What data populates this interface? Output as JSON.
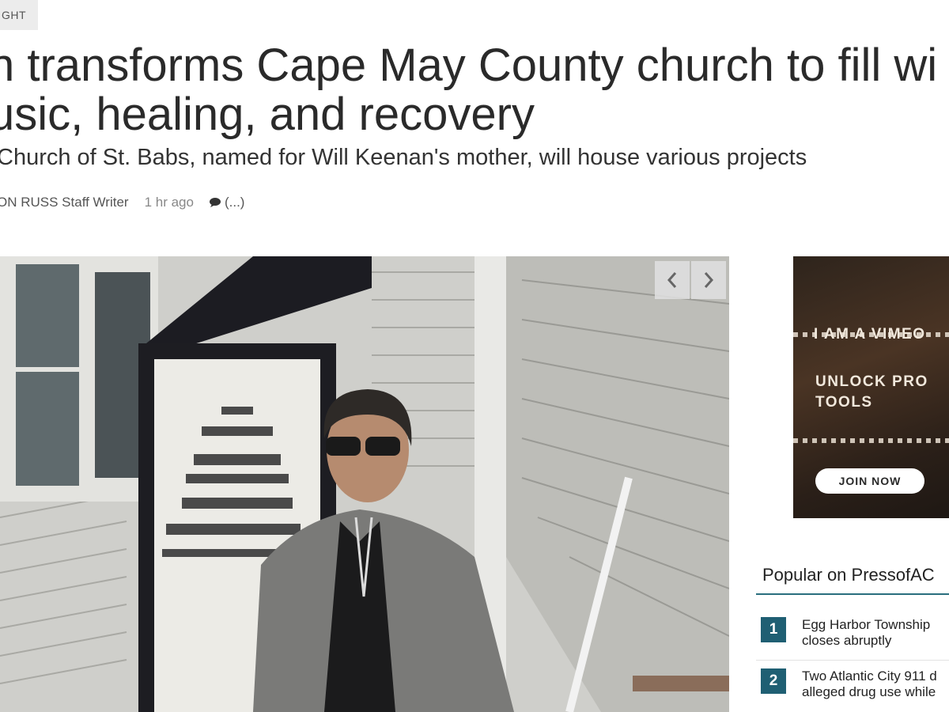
{
  "article": {
    "section_tag": "GHT",
    "headline_line1": "n transforms Cape May County church to fill wi",
    "headline_line2": "usic, healing, and recovery",
    "subheadline": "Church of St. Babs, named for Will Keenan's mother, will house various projects",
    "author": "ON RUSS Staff Writer",
    "timestamp": "1 hr ago",
    "comments": "(...)"
  },
  "gallery": {
    "prev_icon": "chevron-left-icon",
    "next_icon": "chevron-right-icon"
  },
  "ad": {
    "line1": "I AM A VIMEO",
    "line2a": "UNLOCK PRO",
    "line2b": "TOOLS",
    "button": "JOIN NOW"
  },
  "popular": {
    "title": "Popular on PressofAC",
    "items": [
      {
        "rank": "1",
        "line1": "Egg Harbor Township",
        "line2": "closes abruptly"
      },
      {
        "rank": "2",
        "line1": "Two Atlantic City 911 d",
        "line2": "alleged drug use while"
      }
    ]
  },
  "colors": {
    "accent": "#1f5f73",
    "rule": "#2a6f7e"
  }
}
